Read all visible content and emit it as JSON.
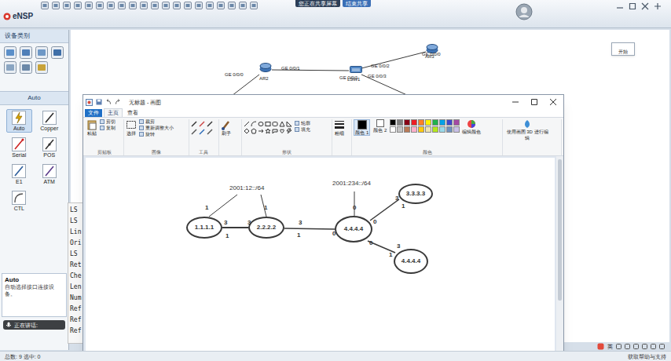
{
  "app": {
    "title": "eNSP",
    "share_status": "您正在共享屏幕",
    "share_stop": "结束共享",
    "start": "开始",
    "ime": "英"
  },
  "device_panel": {
    "title": "设备类别"
  },
  "link_panel": {
    "title": "Auto",
    "items": [
      {
        "label": "Auto",
        "selected": true
      },
      {
        "label": "Copper",
        "selected": false
      },
      {
        "label": "Serial",
        "selected": false
      },
      {
        "label": "POS",
        "selected": false
      },
      {
        "label": "E1",
        "selected": false
      },
      {
        "label": "ATM",
        "selected": false
      },
      {
        "label": "CTL",
        "selected": false
      }
    ]
  },
  "description": {
    "title": "Auto",
    "text": "自动选择接口连接设备。"
  },
  "speaker": {
    "label": "正在讲话:"
  },
  "topology": {
    "devices": [
      {
        "label": "AR2",
        "kind": "router"
      },
      {
        "label": "LSW1",
        "kind": "switch"
      },
      {
        "label": "AR3",
        "kind": "router"
      }
    ],
    "ports": [
      "GE 0/0/0",
      "GE 0/0/1",
      "GE 0/0/1",
      "GE 0/0/2",
      "GE 0/0/3",
      "GE 0/0/0"
    ]
  },
  "terminal": {
    "lines": [
      "LS",
      "LS",
      "Lin",
      "Ori",
      "LS",
      "Ret",
      "Che",
      "Len",
      "Num",
      "Ref",
      "Ref",
      "Ref"
    ]
  },
  "paint": {
    "title": "无标题 - 画图",
    "tabs": [
      {
        "label": "文件",
        "selected": false
      },
      {
        "label": "主页",
        "selected": true
      },
      {
        "label": "查看",
        "selected": false
      }
    ],
    "ribbon": {
      "paste": "粘贴",
      "cut": "剪切",
      "copy": "复制",
      "select": "选择",
      "crop": "裁剪",
      "resize": "重新调整大小",
      "rotate": "旋转",
      "brush": "刷子",
      "outline": "轮廓",
      "fill": "填充",
      "size": "粗细",
      "color1": "颜色 1",
      "color2": "颜色 2",
      "edit_colors": "编辑颜色",
      "paint3d": "使用画图 3D 进行编辑",
      "groups": [
        "剪贴板",
        "图像",
        "工具",
        "形状",
        "颜色"
      ]
    },
    "palette": [
      {
        "color": "#000000"
      },
      {
        "color": "#7f7f7f"
      },
      {
        "color": "#880015"
      },
      {
        "color": "#ed1c24"
      },
      {
        "color": "#ff7f27"
      },
      {
        "color": "#fff200"
      },
      {
        "color": "#22b14c"
      },
      {
        "color": "#00a2e8"
      },
      {
        "color": "#3f48cc"
      },
      {
        "color": "#a349a4"
      },
      {
        "color": "#ffffff"
      },
      {
        "color": "#c3c3c3"
      },
      {
        "color": "#b97a57"
      },
      {
        "color": "#ffaec9"
      },
      {
        "color": "#ffc90e"
      },
      {
        "color": "#efe4b0"
      },
      {
        "color": "#b5e61d"
      },
      {
        "color": "#99d9ea"
      },
      {
        "color": "#7092be"
      },
      {
        "color": "#c8bfe7"
      }
    ],
    "diagram": {
      "nodes": [
        "1.1.1.1",
        "2.2.2.2",
        "4.4.4.4",
        "3.3.3.3",
        "4.4.4.4"
      ],
      "prefixes": [
        "2001:12::/64",
        "2001:234::/64"
      ],
      "labels": [
        "1",
        "1",
        "3",
        "3",
        "1",
        "3",
        "1",
        "0",
        "0",
        "0",
        "3",
        "1",
        "0",
        "3",
        "1"
      ]
    }
  },
  "status_bar": {
    "left": "总数: 9 选中: 0",
    "right": "获取帮助与支持"
  }
}
